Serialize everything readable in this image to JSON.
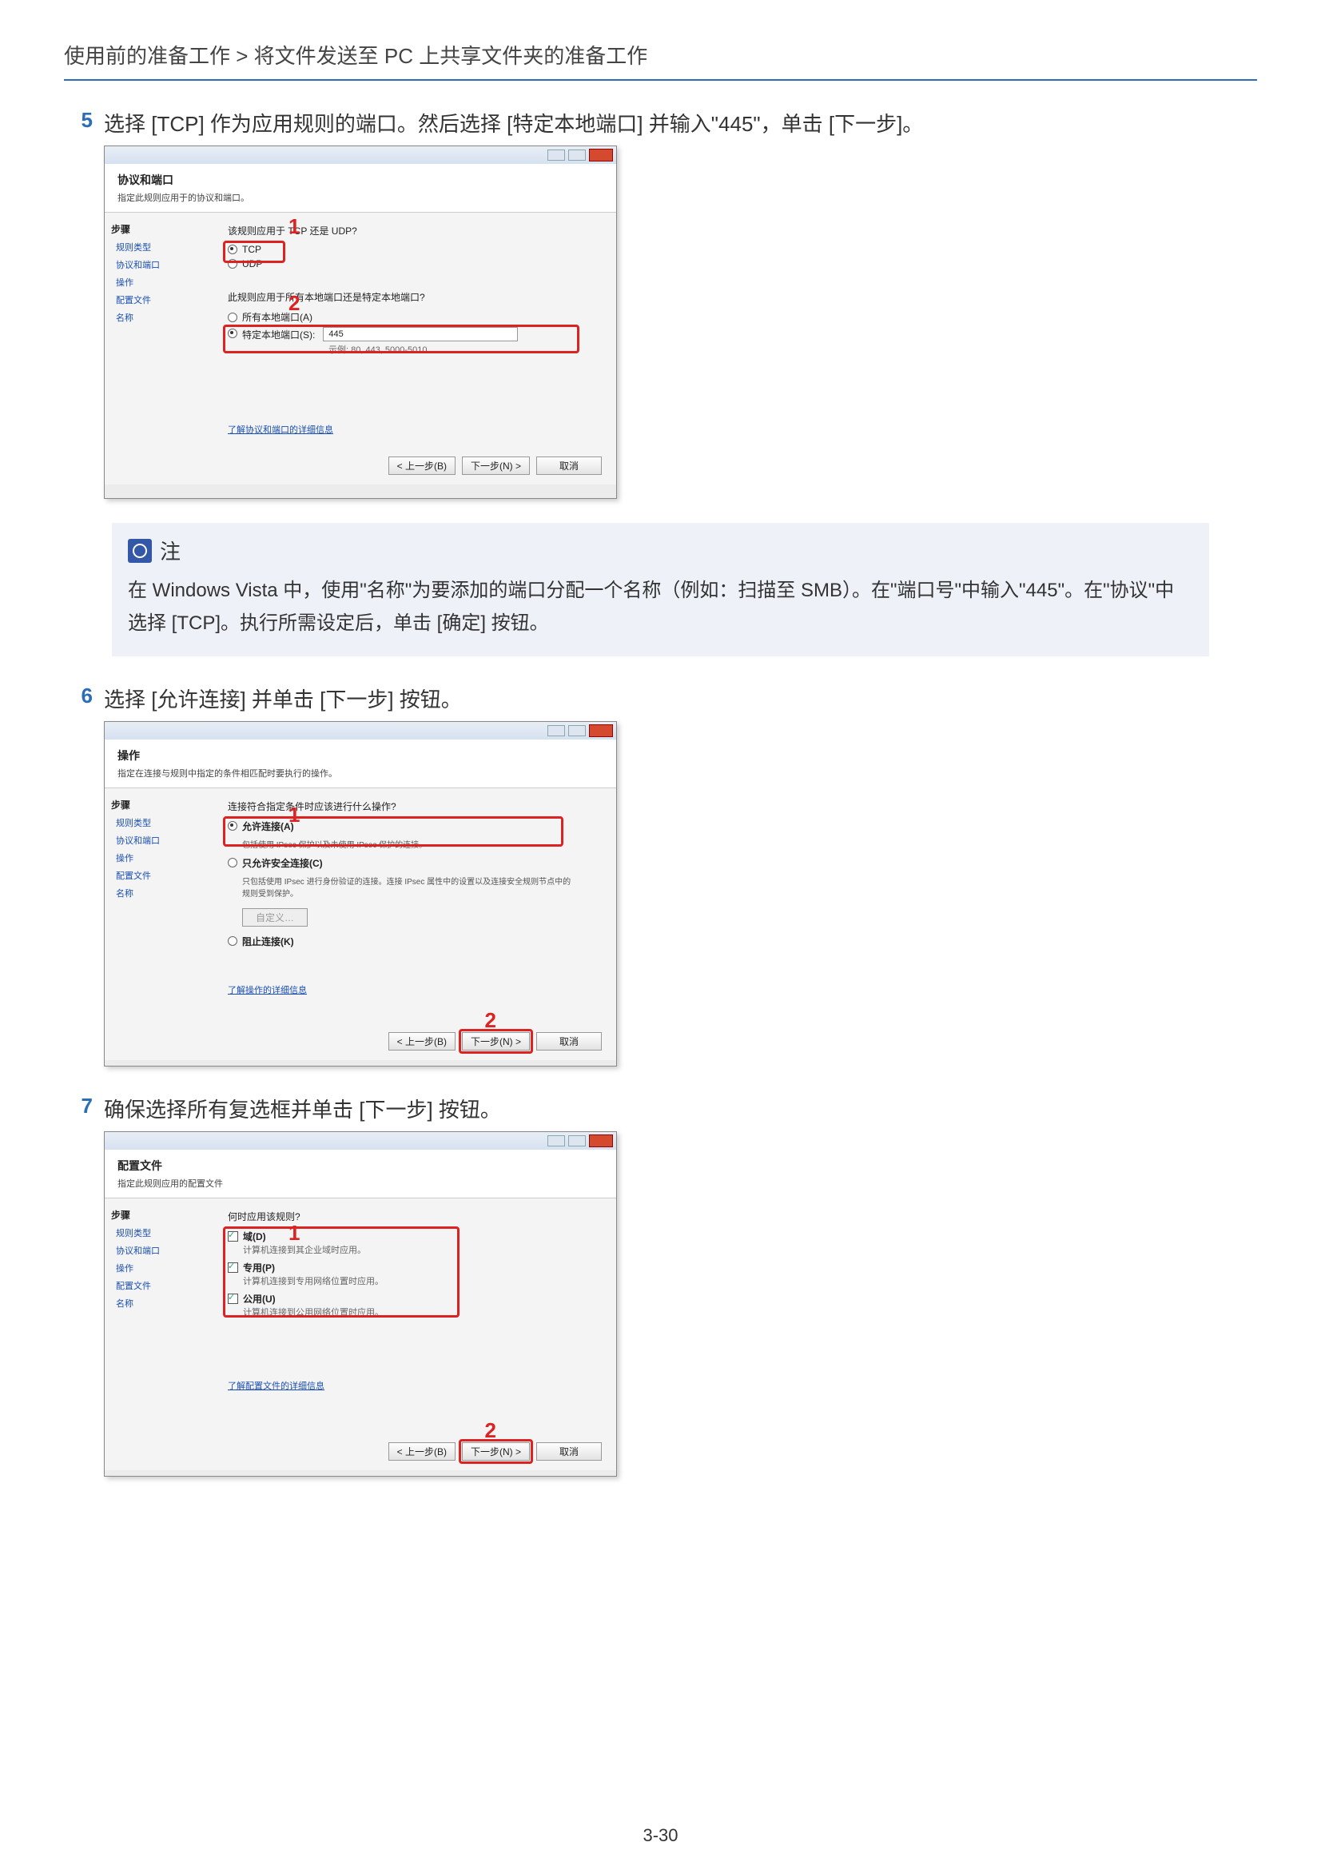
{
  "breadcrumb": "使用前的准备工作 > 将文件发送至 PC 上共享文件夹的准备工作",
  "page_number": "3-30",
  "note": {
    "title": "注",
    "body": "在 Windows Vista 中，使用\"名称\"为要添加的端口分配一个名称（例如：扫描至 SMB）。在\"端口号\"中输入\"445\"。在\"协议\"中选择 [TCP]。执行所需设定后，单击 [确定] 按钮。"
  },
  "steps": {
    "s5": {
      "num": "5",
      "text": "选择 [TCP] 作为应用规则的端口。然后选择 [特定本地端口] 并输入\"445\"，单击 [下一步]。"
    },
    "s6": {
      "num": "6",
      "text": "选择 [允许连接] 并单击 [下一步] 按钮。"
    },
    "s7": {
      "num": "7",
      "text": "确保选择所有复选框并单击 [下一步] 按钮。"
    }
  },
  "dlg_common": {
    "sidebar_title": "步骤",
    "help_link_ports": "了解协议和端口的详细信息",
    "help_link_action": "了解操作的详细信息",
    "help_link_profile": "了解配置文件的详细信息",
    "back": "< 上一步(B)",
    "next": "下一步(N) >",
    "cancel": "取消"
  },
  "dlg5": {
    "title": "协议和端口",
    "subtitle": "指定此规则应用于的协议和端口。",
    "sidebar": [
      "规则类型",
      "协议和端口",
      "操作",
      "配置文件",
      "名称"
    ],
    "q1": "该规则应用于 TCP 还是 UDP?",
    "opt_tcp": "TCP",
    "opt_udp": "UDP",
    "q2": "此规则应用于所有本地端口还是特定本地端口?",
    "opt_all": "所有本地端口(A)",
    "opt_spec": "特定本地端口(S):",
    "port_value": "445",
    "port_hint": "示例: 80, 443, 5000-5010",
    "callout1": "1",
    "callout2": "2"
  },
  "dlg6": {
    "title": "操作",
    "subtitle": "指定在连接与规则中指定的条件相匹配时要执行的操作。",
    "sidebar": [
      "规则类型",
      "协议和端口",
      "操作",
      "配置文件",
      "名称"
    ],
    "q1": "连接符合指定条件时应该进行什么操作?",
    "opt_allow": "允许连接(A)",
    "opt_allow_desc": "包括使用 IPsec 保护以及未使用 IPsec 保护的连接。",
    "opt_secure": "只允许安全连接(C)",
    "opt_secure_desc": "只包括使用 IPsec 进行身份验证的连接。连接 IPsec 属性中的设置以及连接安全规则节点中的规则受到保护。",
    "custom_btn": "自定义…",
    "opt_block": "阻止连接(K)",
    "callout1": "1",
    "callout2": "2"
  },
  "dlg7": {
    "title": "配置文件",
    "subtitle": "指定此规则应用的配置文件",
    "sidebar": [
      "规则类型",
      "协议和端口",
      "操作",
      "配置文件",
      "名称"
    ],
    "q1": "何时应用该规则?",
    "chk_domain": "域(D)",
    "chk_domain_desc": "计算机连接到其企业域时应用。",
    "chk_private": "专用(P)",
    "chk_private_desc": "计算机连接到专用网络位置时应用。",
    "chk_public": "公用(U)",
    "chk_public_desc": "计算机连接到公用网络位置时应用。",
    "callout1": "1",
    "callout2": "2"
  }
}
